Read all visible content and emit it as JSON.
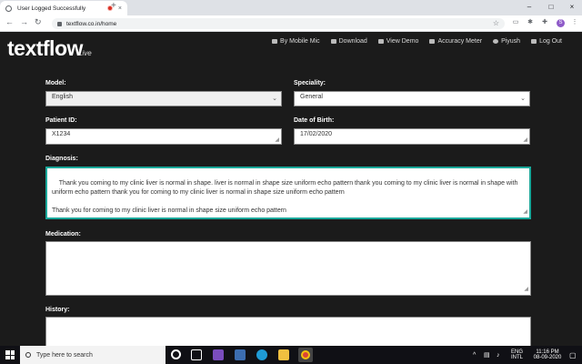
{
  "browser": {
    "tab_title": "User Logged Successfully",
    "tab_close": "×",
    "new_tab": "+",
    "url": "textflow.co.in/home",
    "profile_initial": "S",
    "window_controls": {
      "minimize": "–",
      "maximize": "□",
      "close": "×"
    }
  },
  "app": {
    "brand": "textflow",
    "brand_sub": "Live",
    "nav": [
      {
        "label": "By Mobile Mic"
      },
      {
        "label": "Download"
      },
      {
        "label": "View Demo"
      },
      {
        "label": "Accuracy Meter"
      },
      {
        "label": "Piyush"
      },
      {
        "label": "Log Out"
      }
    ]
  },
  "form": {
    "model": {
      "label": "Model:",
      "value": "English"
    },
    "speciality": {
      "label": "Speciality:",
      "value": "General"
    },
    "patient_id": {
      "label": "Patient ID:",
      "value": "X1234"
    },
    "dob": {
      "label": "Date of Birth:",
      "value": "17/02/2020"
    },
    "diagnosis": {
      "label": "Diagnosis:",
      "value": "Thank you coming to my clinic liver is normal in shape. liver is normal in shape size uniform echo pattern thank you coming to my clinic liver is normal in shape with uniform echo pattern thank you for coming to my clinic liver is normal in shape size uniform echo pattern\n\nThank you for coming to my clinic liver is normal in shape size uniform echo pattern"
    },
    "medication": {
      "label": "Medication:",
      "value": ""
    },
    "history": {
      "label": "History:",
      "value": ""
    }
  },
  "taskbar": {
    "search_placeholder": "Type here to search",
    "lang_top": "ENG",
    "lang_bottom": "INTL",
    "time": "11:16 PM",
    "date": "08-09-2020"
  }
}
